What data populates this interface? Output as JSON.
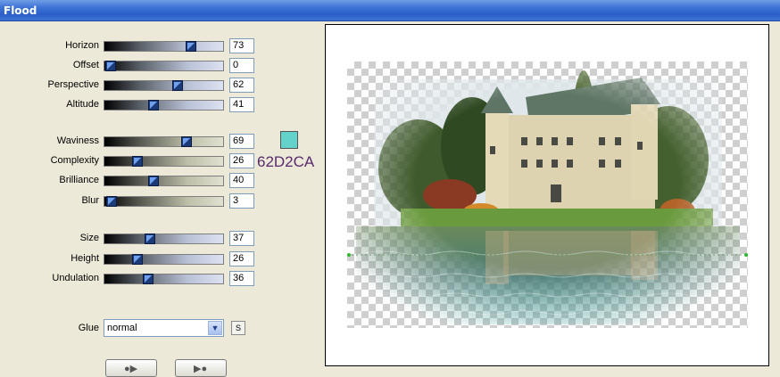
{
  "window": {
    "title": "Flood"
  },
  "params_group1": [
    {
      "label": "Horizon",
      "value": "73",
      "frac": 0.73
    },
    {
      "label": "Offset",
      "value": "0",
      "frac": 0.0
    },
    {
      "label": "Perspective",
      "value": "62",
      "frac": 0.62
    },
    {
      "label": "Altitude",
      "value": "41",
      "frac": 0.41
    }
  ],
  "params_group2": [
    {
      "label": "Waviness",
      "value": "69",
      "frac": 0.69
    },
    {
      "label": "Complexity",
      "value": "26",
      "frac": 0.26
    },
    {
      "label": "Brilliance",
      "value": "40",
      "frac": 0.4
    },
    {
      "label": "Blur",
      "value": "3",
      "frac": 0.03
    }
  ],
  "params_group3": [
    {
      "label": "Size",
      "value": "37",
      "frac": 0.37
    },
    {
      "label": "Height",
      "value": "26",
      "frac": 0.26
    },
    {
      "label": "Undulation",
      "value": "36",
      "frac": 0.36
    }
  ],
  "color": {
    "hex_label": "62D2CA",
    "swatch": "#62D2CA"
  },
  "glue": {
    "label": "Glue",
    "value": "normal"
  },
  "reset_button": {
    "label": "S"
  },
  "preview": {
    "subject": "castle by lake with water reflection over transparent checkerboard"
  },
  "colors": {
    "title_bar": "#3E74D6",
    "thumb": "#1D3A78",
    "dialog_bg": "#ECE9D8"
  }
}
